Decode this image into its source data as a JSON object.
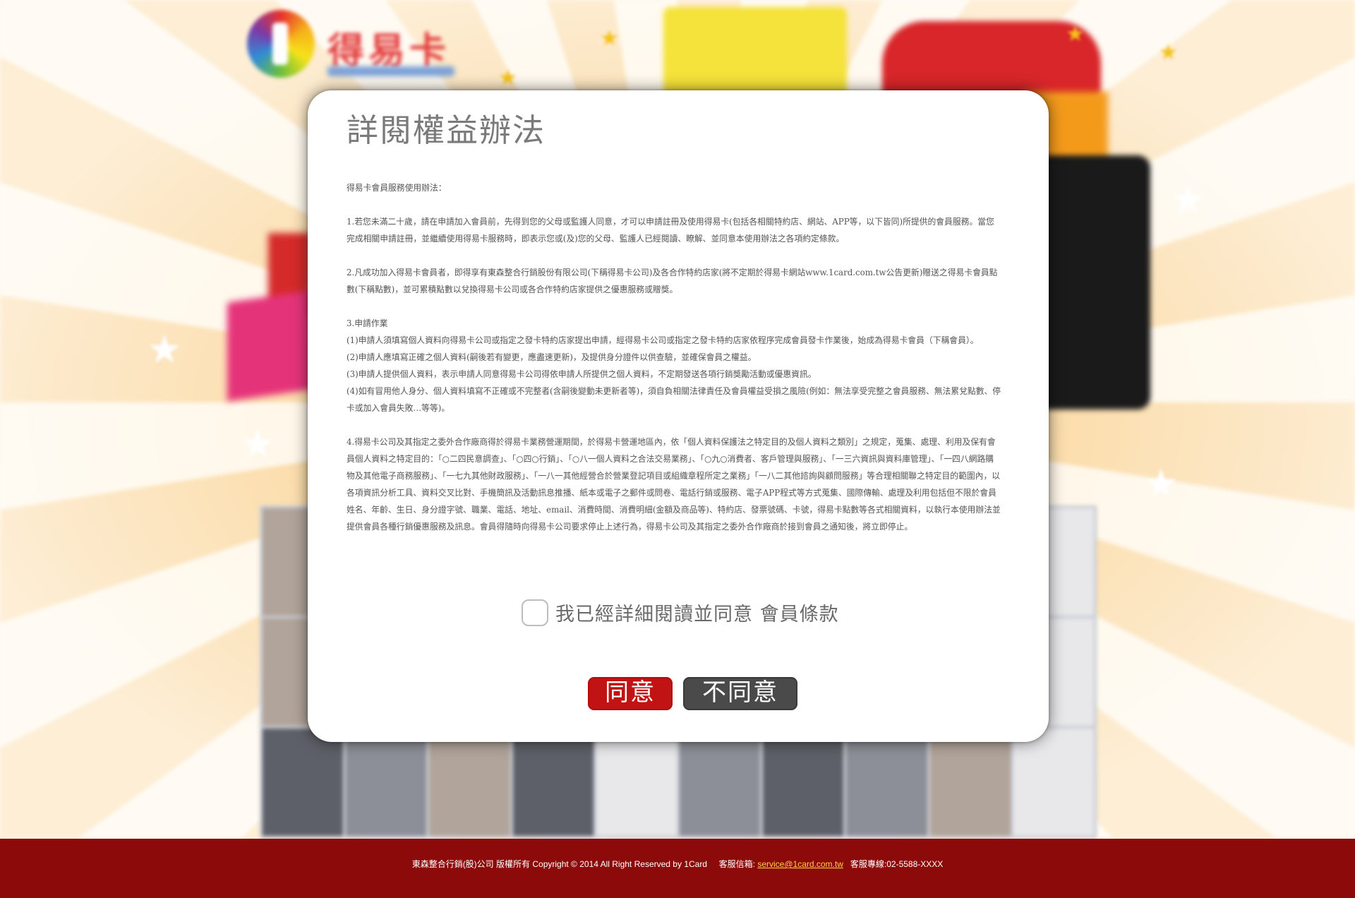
{
  "modal": {
    "title": "詳閱權益辦法",
    "terms": {
      "intro": "得易卡會員服務使用辦法：",
      "p1": "1.若您未滿二十歲，請在申請加入會員前，先得到您的父母或監護人同意，才可以申請註冊及使用得易卡(包括各相關特約店、網站、APP等，以下皆同)所提供的會員服務。當您完成相關申請註冊，並繼續使用得易卡服務時，即表示您或(及)您的父母、監護人已經閱讀、瞭解、並同意本使用辦法之各項約定條款。",
      "p2": "2.凡成功加入得易卡會員者，即得享有東森整合行銷股份有限公司(下稱得易卡公司)及各合作特約店家(將不定期於得易卡網站www.1card.com.tw公告更新)贈送之得易卡會員點數(下稱點數)，並可累積點數以兌換得易卡公司或各合作特約店家提供之優惠服務或贈獎。",
      "p3_title": "3.申請作業",
      "p3_1": "(1)申請人須填寫個人資料向得易卡公司或指定之發卡特約店家提出申請，經得易卡公司或指定之發卡特約店家依程序完成會員發卡作業後，始成為得易卡會員（下稱會員）。",
      "p3_2": "(2)申請人應填寫正確之個人資料(嗣後若有變更，應盡速更新)，及提供身分證件以供查驗，並確保會員之權益。",
      "p3_3": "(3)申請人提供個人資料，表示申請人同意得易卡公司得依申請人所提供之個人資料，不定期發送各項行銷獎勵活動或優惠資訊。",
      "p3_4": "(4)如有冒用他人身分、個人資料填寫不正確或不完整者(含嗣後變動未更新者等)，須自負相關法律責任及會員權益受損之風險(例如：無法享受完整之會員服務、無法累兌點數、停卡或加入會員失敗…等等)。",
      "p4": "4.得易卡公司及其指定之委外合作廠商得於得易卡業務營運期間，於得易卡營運地區內，依「個人資料保護法之特定目的及個人資料之類別」之規定，蒐集、處理、利用及保有會員個人資料之特定目的：「○二四民意調查」、「○四○行銷」、「○八一個人資料之合法交易業務」、「○九○消費者、客戶管理與服務」、「一三六資訊與資料庫管理」、「一四八網路購物及其他電子商務服務」、「一七九其他財政服務」、「一八一其他經營合於營業登記項目或組織章程所定之業務」「一八二其他諮詢與顧問服務」等合理相關聯之特定目的範圍內，以各項資訊分析工具、資料交叉比對、手機簡訊及活動訊息推播、紙本或電子之郵件或問卷、電話行銷或服務、電子APP程式等方式蒐集、國際傳輸、處理及利用包括但不限於會員姓名、年齡、生日、身分證字號、職業、電話、地址、email、消費時間、消費明細(金額及商品等)、特約店、發票號碼、卡號，得易卡點數等各式相關資料，以執行本使用辦法並提供會員各種行銷優惠服務及訊息。會員得隨時向得易卡公司要求停止上述行為，得易卡公司及其指定之委外合作廠商於接到會員之通知後，將立即停止。"
    },
    "agree_checkbox_label": "我已經詳細閱讀並同意 會員條款",
    "agree_checked": false,
    "buttons": {
      "agree": "同意",
      "disagree": "不同意"
    }
  },
  "background": {
    "logo_text": "得易卡"
  },
  "footer": {
    "copyright": "東森整合行銷(股)公司 版權所有 Copyright © 2014 All Right Reserved by 1Card",
    "service_label": "客服信箱:",
    "service_email": "service@1card.com.tw",
    "hotline_label": "客服專線:02-5588-XXXX"
  },
  "colors": {
    "agree_button": "#c11313",
    "disagree_button": "#4a4a4a",
    "footer_bg": "#8d0a0a"
  }
}
